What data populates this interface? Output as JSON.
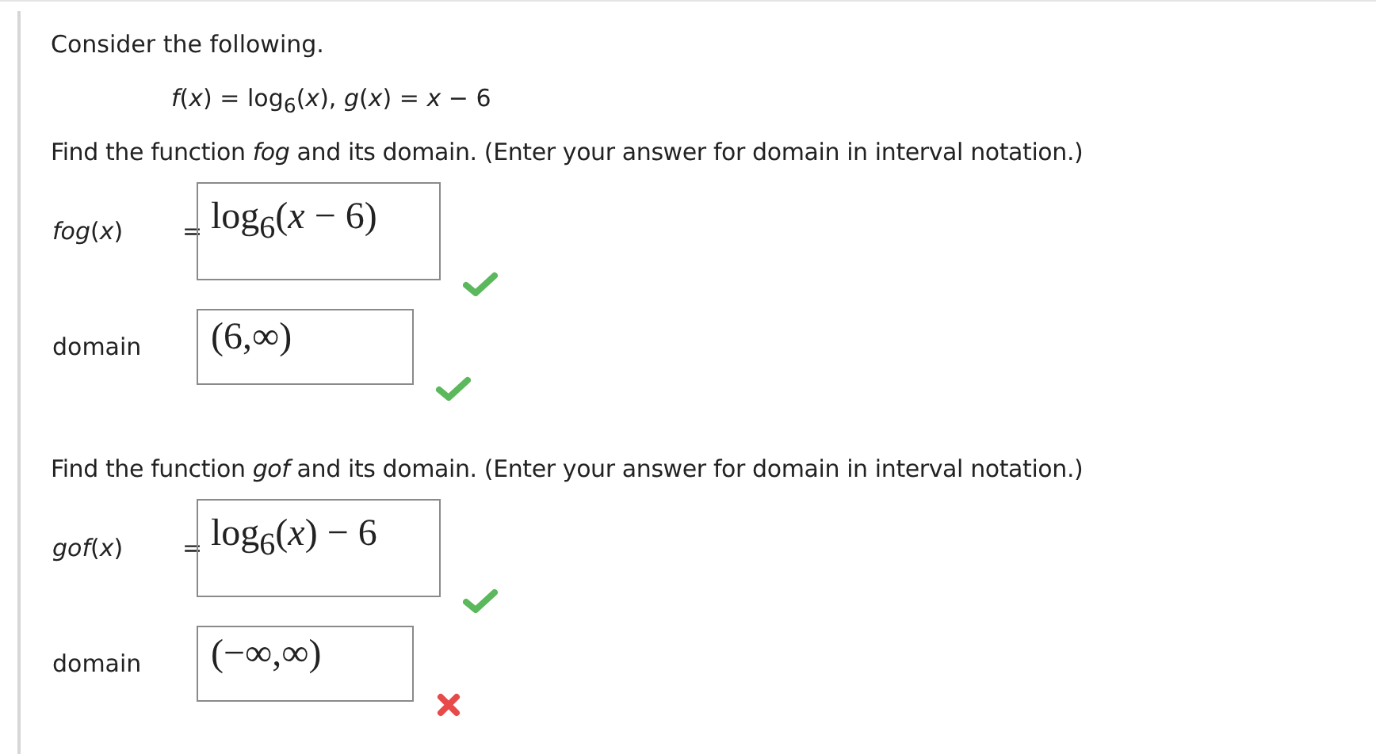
{
  "intro": "Consider the following.",
  "given": "*f*(*x*) = log$_{6}$(*x*),  *g*(*x*) = *x* − 6",
  "parts": [
    {
      "instruction": "Find the function *fog* and its domain. (Enter your answer for domain in interval notation.)",
      "answers": [
        {
          "kind": "function",
          "label": "*fog*(*x*)",
          "equals": "=",
          "value": "log$_{6}$(*x* − 6)",
          "correct": true
        },
        {
          "kind": "domain",
          "label": "domain",
          "value": "(6,∞)",
          "correct": true
        }
      ]
    },
    {
      "instruction": "Find the function *gof* and its domain. (Enter your answer for domain in interval notation.)",
      "answers": [
        {
          "kind": "function",
          "label": "*gof*(*x*)",
          "equals": "=",
          "value": "log$_{6}$(*x*) − 6",
          "correct": true
        },
        {
          "kind": "domain",
          "label": "domain",
          "value": "(−∞,∞)",
          "correct": false
        }
      ]
    }
  ]
}
